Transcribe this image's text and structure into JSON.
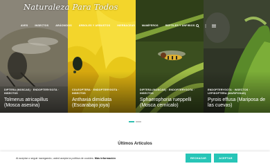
{
  "site": {
    "logo": "Naturaleza Para Todos"
  },
  "nav": {
    "items": [
      "AVES",
      "INSECTOS",
      "ARÁCNIDOS",
      "ÁRBOLES Y ARBUSTOS",
      "HIERBACEAS",
      "MAMÍFEROS",
      "REPTILES Y ANFIBIOS"
    ],
    "icons": [
      "search-icon",
      "more-vertical-icon",
      "menu-icon"
    ]
  },
  "slides": [
    {
      "categories": "DIPTERA (MOSCAS) · ENDOPTERYGOTA · INSECTOS",
      "title": "Tolmerus atricapillus (Mosca asesina)"
    },
    {
      "categories": "COLEOPTERA · ENDOPTERYGOTA · INSECTOS",
      "title": "Anthaxia dimidiata (Escarabajo joya)"
    },
    {
      "categories": "DIPTERA (MOSCAS) · ENDOPTERYGOTA · INSECTOS",
      "title": "Sphaerophoria rueppelli (Mosca cernícalo)"
    },
    {
      "categories": "ENDOPTERYGOTA · INSECTOS · LEPIDOPTERA (MARIPOSAS)",
      "title": "Pyrois effusa (Mariposa de las cuevas)"
    }
  ],
  "slider": {
    "active_page": 1,
    "page_count": 2
  },
  "latest": {
    "title": "Últimos Artículos"
  },
  "cookie": {
    "message": "Al aceptar o seguir navegando, usted acepta la política de cookies.",
    "more_link": "Más información",
    "reject_label": "RECHAZAR",
    "accept_label": "ACEPTAR"
  },
  "colors": {
    "accent": "#27c5b7",
    "active_dot": "#2fbfb1"
  }
}
